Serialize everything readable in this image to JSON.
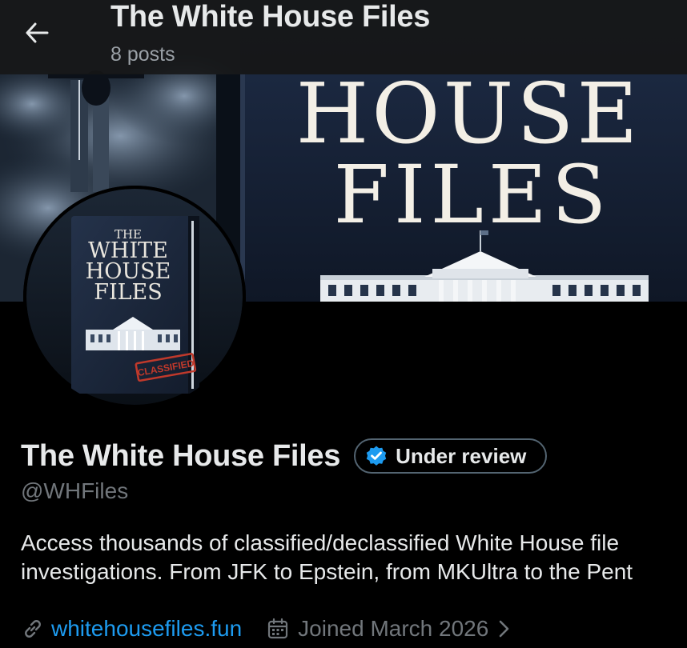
{
  "header": {
    "title": "The White House Files",
    "post_count": "8 posts",
    "back_icon": "arrow-left-icon"
  },
  "banner": {
    "art_line1": "HOUSE",
    "art_line2": "FILES"
  },
  "avatar": {
    "book_title_small": "THE",
    "book_title_line1": "WHITE",
    "book_title_line2": "HOUSE",
    "book_title_line3": "FILES",
    "stamp": "CLASSIFIED"
  },
  "profile": {
    "display_name": "The White House Files",
    "verification_label": "Under review",
    "handle": "@WHFiles",
    "bio_line1": "Access thousands of classified/declassified White House file",
    "bio_line2": "investigations. From JFK to Epstein, from MKUltra to the Pent",
    "website": "whitehousefiles.fun",
    "joined": "Joined March 2026"
  },
  "colors": {
    "background": "#000000",
    "text_primary": "#e7e9ea",
    "text_secondary": "#71767b",
    "link": "#1d9bf0",
    "verified_badge": "#1d9bf0",
    "pill_border": "#536471"
  },
  "icons": {
    "link": "link-icon",
    "calendar": "calendar-icon",
    "chevron": "chevron-right-icon",
    "badge": "verified-badge-icon"
  }
}
